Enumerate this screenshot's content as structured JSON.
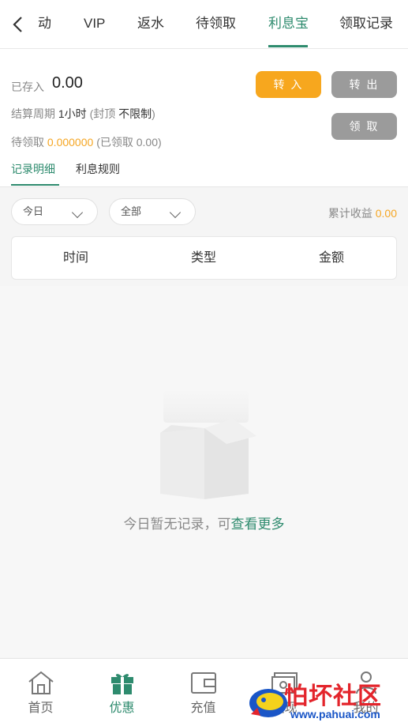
{
  "top_tabs": [
    "动",
    "VIP",
    "返水",
    "待领取",
    "利息宝",
    "领取记录"
  ],
  "summary": {
    "deposited_label": "已存入",
    "deposited_value": "0.00",
    "settle_label": "结算周期",
    "settle_value": "1小时",
    "cap_prefix": "(封顶",
    "cap_value": "不限制",
    "cap_suffix": ")",
    "pending_label": "待领取",
    "pending_value": "0.000000",
    "claimed_text": "(已领取 0.00)"
  },
  "buttons": {
    "transfer_in": "转 入",
    "transfer_out": "转 出",
    "claim": "领 取"
  },
  "sub_tabs": [
    "记录明细",
    "利息规则"
  ],
  "filters": {
    "date": "今日",
    "type": "全部"
  },
  "cumulative": {
    "label": "累计收益",
    "value": "0.00"
  },
  "table_headers": [
    "时间",
    "类型",
    "金额"
  ],
  "empty_state": {
    "text": "今日暂无记录，可",
    "link": "查看更多"
  },
  "bottom_nav": [
    "首页",
    "优惠",
    "充值",
    "提现",
    "我的"
  ],
  "watermark": {
    "title": "怕坏社区",
    "url": "www.pahuai.com"
  },
  "colors": {
    "accent": "#2e8b6e",
    "orange": "#f7a71e",
    "gray_button": "#9b9b9b"
  }
}
